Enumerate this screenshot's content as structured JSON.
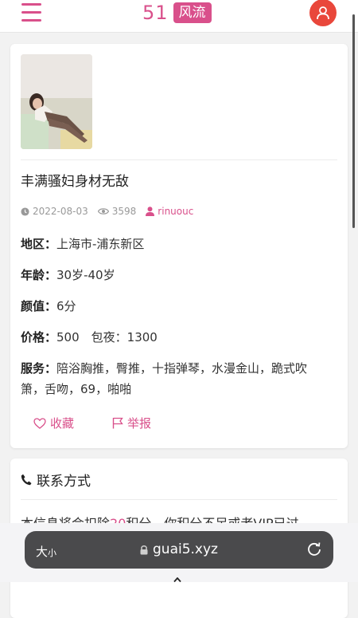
{
  "header": {
    "brand_number": "51",
    "brand_tag": "风流",
    "menu_icon": "hamburger-menu-icon",
    "user_icon": "user-icon"
  },
  "post": {
    "title": "丰满骚妇身材无敌",
    "date": "2022-08-03",
    "views": "3598",
    "author": "rinuouc",
    "fields": [
      {
        "label": "地区：",
        "value": "上海市-浦东新区"
      },
      {
        "label": "年龄：",
        "value": "30岁-40岁"
      },
      {
        "label": "颜值：",
        "value": "6分"
      },
      {
        "label": "价格：",
        "value": "500　包夜：1300"
      },
      {
        "label": "服务：",
        "value": "陪浴胸推，臀推，十指弹琴，水漫金山，跪式吹箫，舌吻，69，啪啪"
      }
    ],
    "actions": {
      "favorite": "收藏",
      "report": "举报"
    }
  },
  "contact": {
    "heading": "联系方式",
    "text_before": "本信息将会扣除",
    "points": "20",
    "text_after": "积分，你积分不足或者VIP已过"
  },
  "browser": {
    "size_label": "大",
    "size_small": "小",
    "url": "guai5.xyz"
  },
  "colors": {
    "accent": "#d9508b",
    "user_button": "#e9473b"
  }
}
